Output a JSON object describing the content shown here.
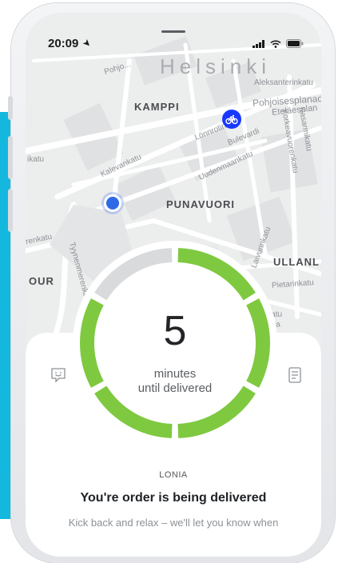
{
  "status_bar": {
    "time": "20:09"
  },
  "map": {
    "labels": {
      "helsinki": "Helsinki",
      "pohjois": "Pohjo...",
      "aleksanterinkatu": "Aleksanterinkatu",
      "pohjoisesplanadi": "Pohjoisesplanad",
      "etelaesplanadi": "Eteläesplan",
      "kamppi": "KAMPPI",
      "lonnrotinkatu": "Lönnrotinkatu",
      "bulevardi": "Bulevardi",
      "korkeavuorenkatu": "Korkeavuorenkatu",
      "kasarmikatu": "Kasarmikatu",
      "katu": "ikatu",
      "kalevankatu": "Kalevankatu",
      "uudenmaankatu": "Uudenmaankatu",
      "punavuori": "PUNAVUORI",
      "renkatu": "renkatu",
      "tyynenmerenkatu": "Tyynenmerenkatu",
      "laivurinkatu": "Laivurinkatu",
      "ullanlinna": "ULLANL",
      "pietarinkatu": "Pietarinkatu",
      "our": "OUR",
      "ikatu2": "ikatu",
      "ranta": "ranta"
    }
  },
  "delivery": {
    "minutes": "5",
    "subtitle_line1": "minutes",
    "subtitle_line2": "until delivered",
    "progress_fraction": 0.83
  },
  "order": {
    "restaurant": "LONIA",
    "headline": "You're order is being delivered",
    "body": "Kick back and relax – we'll let you know when"
  },
  "icons": {
    "left": "chat-smiley-icon",
    "right": "receipt-icon",
    "pin": "bicycle-icon"
  },
  "colors": {
    "ring_green": "#7fc940",
    "ring_gray": "#d9dadc",
    "bike_pin": "#1838ff",
    "side_strip": "#14b8df"
  }
}
